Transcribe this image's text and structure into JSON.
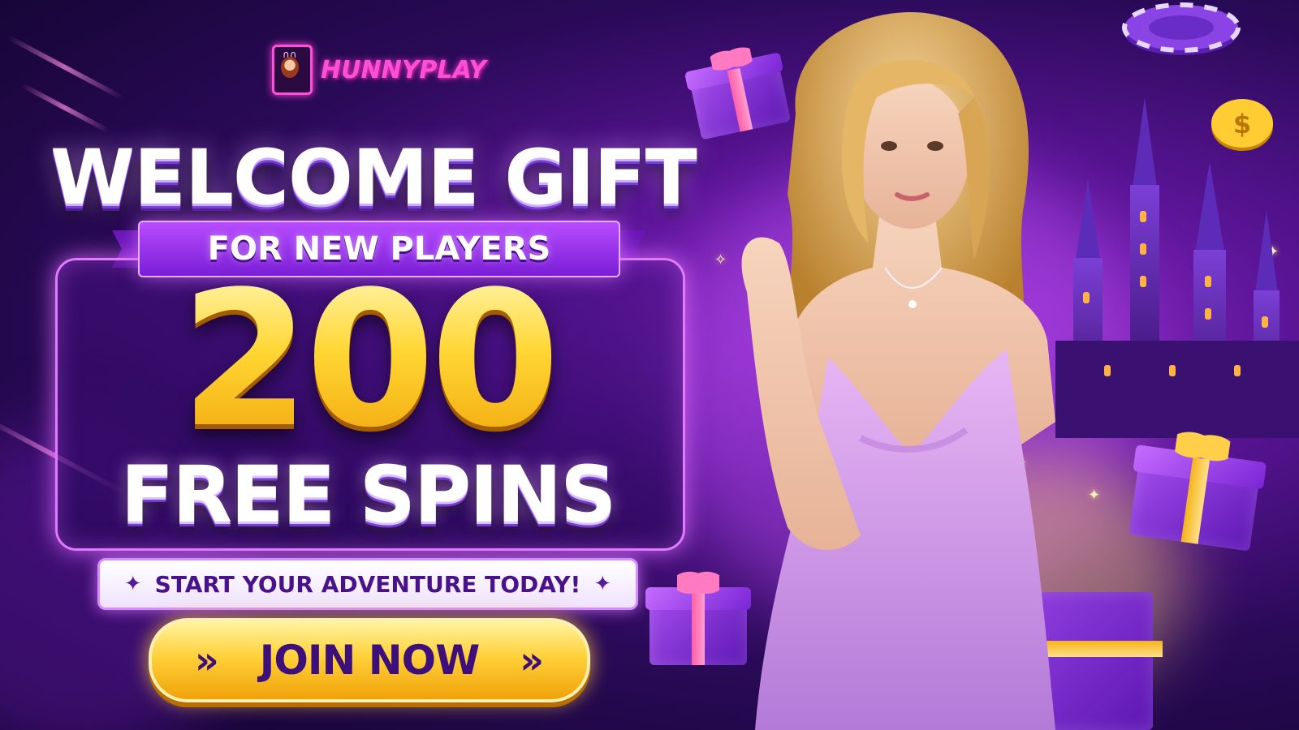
{
  "brand": {
    "logo_text": "HUNNYPLAY",
    "logo_icon": "bunny-card-icon"
  },
  "promo": {
    "headline": "WELCOME GIFT",
    "ribbon": "FOR NEW PLAYERS",
    "amount": "200",
    "amount_label": "FREE SPINS",
    "tagline": "START YOUR ADVENTURE TODAY!",
    "cta_label": "JOIN NOW"
  },
  "icons": {
    "tagline_left": "sparkle-icon",
    "tagline_right": "sparkle-icon",
    "cta_left": "double-chevron-right-icon",
    "cta_right": "double-chevron-right-icon"
  },
  "colors": {
    "background": "#2a0a58",
    "accent_pink": "#ff4fd8",
    "accent_purple": "#b84cff",
    "gold": "#ffd43b",
    "cta_text": "#3d0f7a"
  }
}
